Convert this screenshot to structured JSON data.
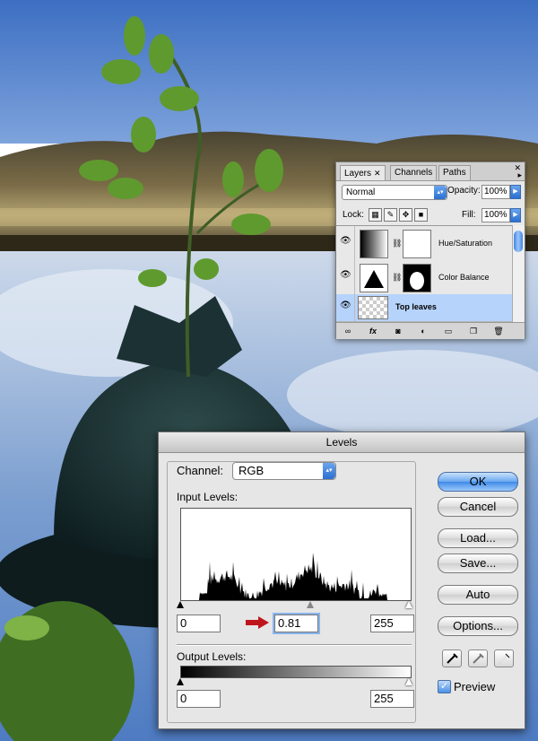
{
  "layers_panel": {
    "tabs": [
      "Layers",
      "Channels",
      "Paths"
    ],
    "tab_close": "✕",
    "blend_mode": "Normal",
    "opacity_label": "Opacity:",
    "opacity_value": "100%",
    "lock_label": "Lock:",
    "fill_label": "Fill:",
    "fill_value": "100%",
    "layers": [
      {
        "name": "Hue/Saturation",
        "visible": true,
        "type": "adjustment"
      },
      {
        "name": "Color Balance",
        "visible": true,
        "type": "adjustment"
      },
      {
        "name": "Top leaves",
        "visible": true,
        "type": "pixel",
        "selected": true
      }
    ],
    "bottom_fx": "fx"
  },
  "levels_dialog": {
    "title": "Levels",
    "channel_label": "Channel:",
    "channel_value": "RGB",
    "input_levels_label": "Input Levels:",
    "input_black": "0",
    "input_gamma": "0.81",
    "input_white": "255",
    "output_levels_label": "Output Levels:",
    "output_black": "0",
    "output_white": "255",
    "buttons": {
      "ok": "OK",
      "cancel": "Cancel",
      "load": "Load...",
      "save": "Save...",
      "auto": "Auto",
      "options": "Options..."
    },
    "preview_label": "Preview",
    "preview_checked": true,
    "colors": {
      "accent": "#3f8ae8",
      "arrow": "#c0141c"
    }
  }
}
